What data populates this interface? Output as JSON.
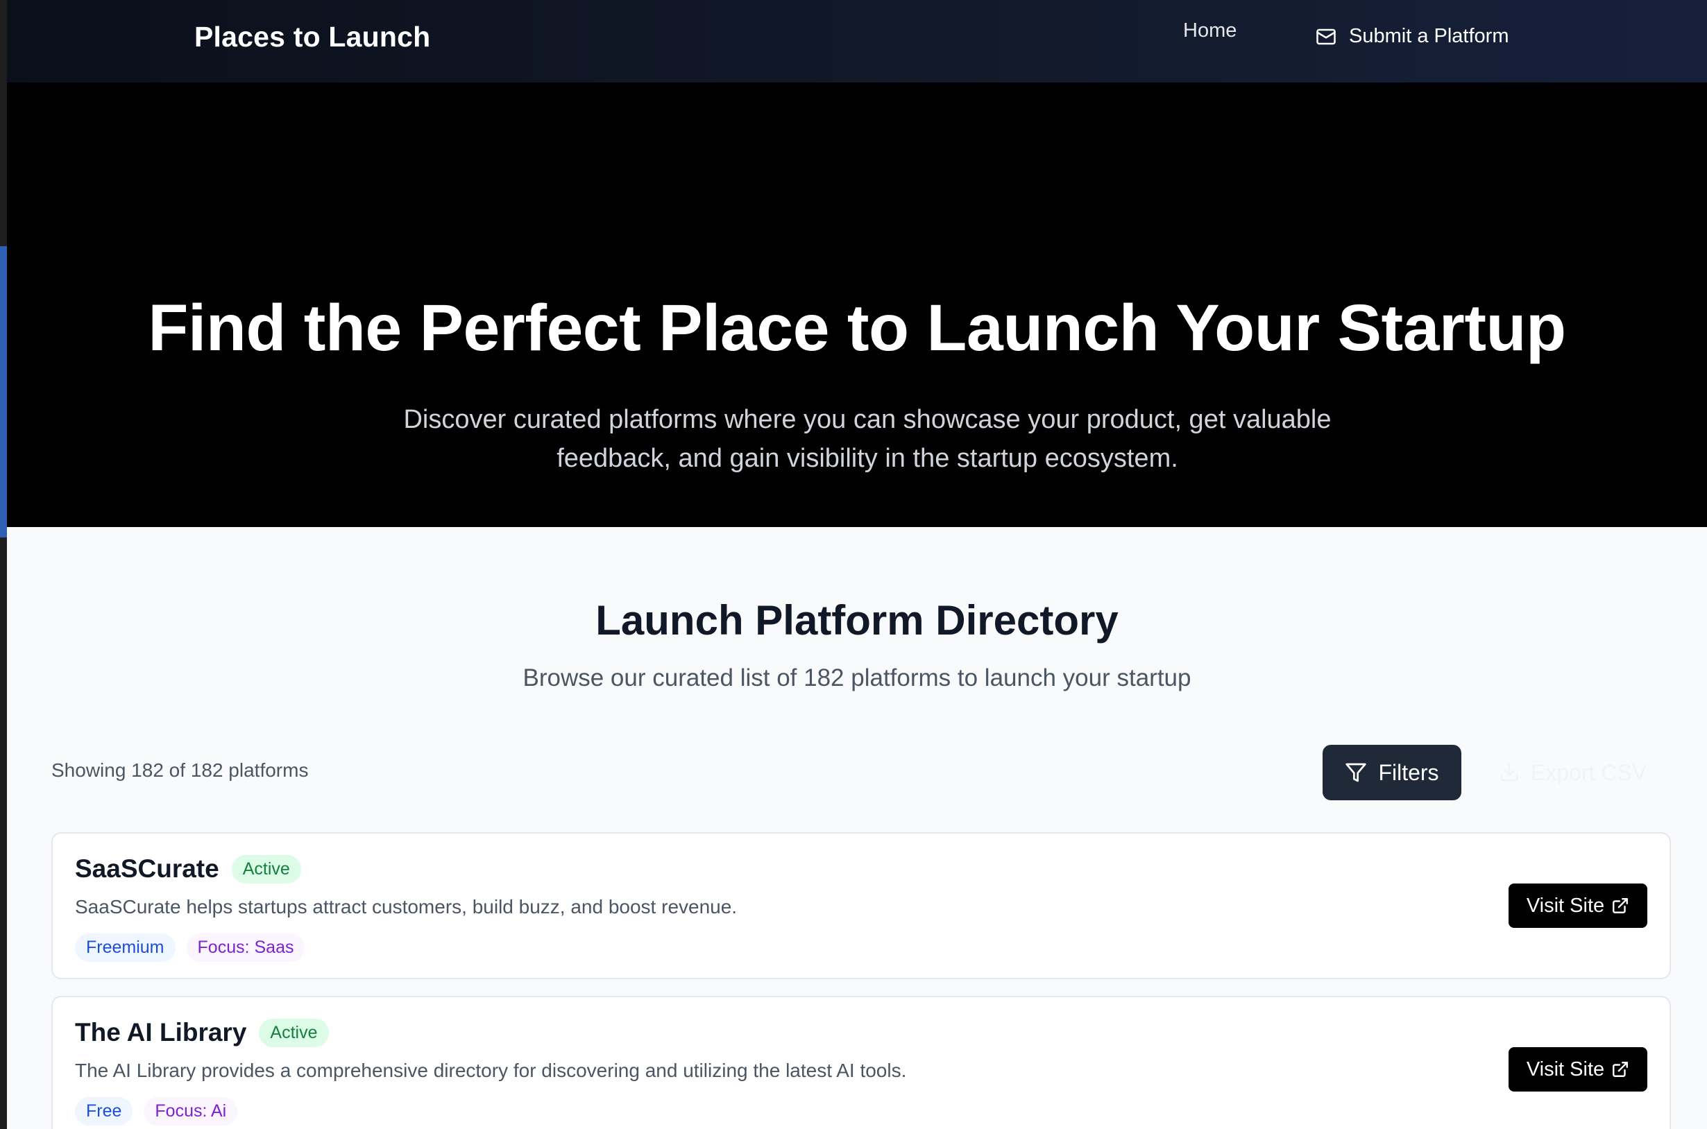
{
  "nav": {
    "brand": "Places to Launch",
    "home": "Home",
    "submit": "Submit a Platform"
  },
  "hero": {
    "title": "Find the Perfect Place to Launch Your Startup",
    "subtitle": "Discover curated platforms where you can showcase your product, get valuable feedback, and gain visibility in the startup ecosystem."
  },
  "directory": {
    "title": "Launch Platform Directory",
    "subtitle": "Browse our curated list of 182 platforms to launch your startup",
    "showing": "Showing 182 of 182 platforms",
    "filters_label": "Filters",
    "export_label": "Export CSV"
  },
  "platforms": [
    {
      "name": "SaaSCurate",
      "status": "Active",
      "description": "SaaSCurate helps startups attract customers, build buzz, and boost revenue.",
      "pricing": "Freemium",
      "focus": "Focus: Saas",
      "visit_label": "Visit Site"
    },
    {
      "name": "The AI Library",
      "status": "Active",
      "description": "The AI Library provides a comprehensive directory for discovering and utilizing the latest AI tools.",
      "pricing": "Free",
      "focus": "Focus: Ai",
      "visit_label": "Visit Site"
    }
  ],
  "icons": {
    "submit": "mail-icon",
    "filters": "filter-icon",
    "export": "download-icon",
    "visit": "external-link-icon"
  }
}
